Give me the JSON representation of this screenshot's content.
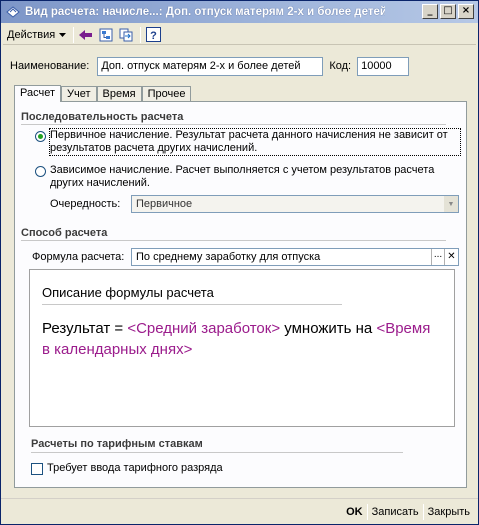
{
  "window": {
    "title": "Вид расчета: начисле...: Доп. отпуск матерям 2-х и более детей"
  },
  "toolbar": {
    "actions_label": "Действия",
    "icons": [
      "back-arrow-icon",
      "structure-icon",
      "refresh-icon",
      "help-icon"
    ],
    "help_glyph": "?"
  },
  "header": {
    "name_label": "Наименование:",
    "name_value": "Доп. отпуск матерям 2-х и более детей",
    "code_label": "Код:",
    "code_value": "10000"
  },
  "tabs": [
    {
      "label": "Расчет",
      "active": true
    },
    {
      "label": "Учет",
      "active": false
    },
    {
      "label": "Время",
      "active": false
    },
    {
      "label": "Прочее",
      "active": false
    }
  ],
  "sequence": {
    "title": "Последовательность расчета",
    "options": [
      {
        "label": "Первичное начисление. Результат расчета данного начисления не зависит от результатов расчета других начислений.",
        "checked": true
      },
      {
        "label": "Зависимое начисление. Расчет выполняется с учетом результатов расчета других начислений.",
        "checked": false
      }
    ],
    "order_label": "Очередность:",
    "order_value": "Первичное"
  },
  "method": {
    "title": "Способ расчета",
    "formula_label": "Формула расчета:",
    "formula_value": "По среднему заработку для отпуска",
    "dots_glyph": "...",
    "clear_glyph": "✕"
  },
  "description": {
    "title": "Описание формулы расчета",
    "prefix": "Результат = ",
    "term1": "<Средний заработок>",
    "middle": " умножить на ",
    "term2": "<Время в календарных днях>"
  },
  "tariff": {
    "title": "Расчеты по тарифным ставкам",
    "checkbox_label": "Требует ввода тарифного разряда",
    "checked": false
  },
  "buttons": {
    "ok": "OK",
    "save": "Записать",
    "close": "Закрыть"
  },
  "colors": {
    "accent_purple": "#9b1c8c",
    "titlebar": "#7d96c8"
  }
}
